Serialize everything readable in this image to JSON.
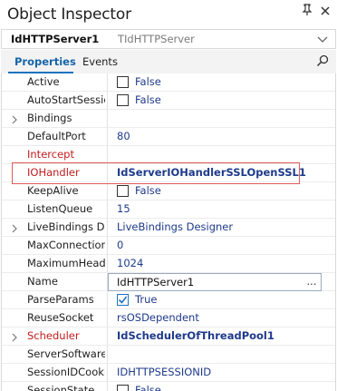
{
  "window": {
    "title": "Object Inspector",
    "pin_icon": "pin-icon",
    "close_icon": "close-icon"
  },
  "component": {
    "name": "IdHTTPServer1",
    "class": "TIdHTTPServer"
  },
  "tabs": {
    "properties": "Properties",
    "events": "Events"
  },
  "colors": {
    "accent": "#1e73be",
    "highlight_border": "#e05a5a",
    "value_text": "#1e3a8a",
    "red_property": "#c21c1c"
  },
  "properties": [
    {
      "name": "Active",
      "value": "False",
      "checkbox": true,
      "checked": false
    },
    {
      "name": "AutoStartSession",
      "value": "False",
      "checkbox": true,
      "checked": false
    },
    {
      "name": "Bindings",
      "value": "",
      "expandable": true
    },
    {
      "name": "DefaultPort",
      "value": "80"
    },
    {
      "name": "Intercept",
      "value": "",
      "red": true
    },
    {
      "name": "IOHandler",
      "value": "IdServerIOHandlerSSLOpenSSL1",
      "red": true,
      "bold": true
    },
    {
      "name": "KeepAlive",
      "value": "False",
      "checkbox": true,
      "checked": false
    },
    {
      "name": "ListenQueue",
      "value": "15"
    },
    {
      "name": "LiveBindings Designer",
      "value": "LiveBindings Designer",
      "expandable": true
    },
    {
      "name": "MaxConnections",
      "value": "0"
    },
    {
      "name": "MaximumHeaderLineCount",
      "value": "1024"
    },
    {
      "name": "Name",
      "value": "IdHTTPServer1",
      "editing": true,
      "ellipsis": "..."
    },
    {
      "name": "ParseParams",
      "value": "True",
      "checkbox": true,
      "checked": true
    },
    {
      "name": "ReuseSocket",
      "value": "rsOSDependent"
    },
    {
      "name": "Scheduler",
      "value": "IdSchedulerOfThreadPool1",
      "red": true,
      "bold": true,
      "expandable": true
    },
    {
      "name": "ServerSoftware",
      "value": ""
    },
    {
      "name": "SessionIDCookieName",
      "value": "IDHTTPSESSIONID"
    },
    {
      "name": "SessionState",
      "value": "False",
      "checkbox": true,
      "checked": false
    }
  ]
}
